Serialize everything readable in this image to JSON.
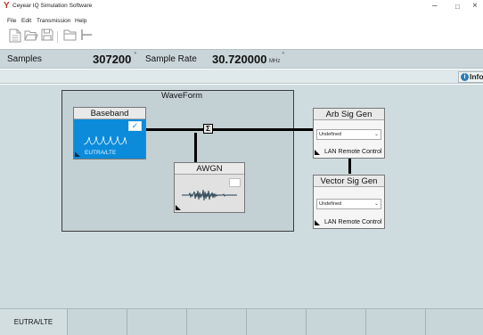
{
  "window": {
    "title": "Ceyear IQ Simulation Software",
    "minimize_glyph": "–",
    "maximize_glyph": "□",
    "close_glyph": "×",
    "icon": "app-logo-icon"
  },
  "menu": {
    "file": "File",
    "edit": "Edit",
    "transmission": "Transmission",
    "help": "Help"
  },
  "toolbar": {
    "icons": [
      "new-file-icon",
      "open-file-icon",
      "save-file-icon",
      "open-folder-icon",
      "branch-icon"
    ]
  },
  "status": {
    "samples_label": "Samples",
    "samples_value": "307200",
    "sample_rate_label": "Sample Rate",
    "sample_rate_value": "30.720000",
    "sample_rate_unit": "MHz"
  },
  "info_tab": {
    "label": "Info",
    "icon_glyph": "i"
  },
  "canvas": {
    "waveform_title": "WaveForm",
    "summing_symbol": "Σ",
    "baseband": {
      "title": "Baseband",
      "standard": "EUTRA/LTE",
      "check_glyph": "✓",
      "enabled": true
    },
    "awgn": {
      "title": "AWGN",
      "enabled": false
    },
    "arb_sig_gen": {
      "title": "Arb Sig Gen",
      "instrument": "Undefined",
      "connection": "LAN Remote Control"
    },
    "vector_sig_gen": {
      "title": "Vector Sig Gen",
      "instrument": "Undefined",
      "connection": "LAN Remote Control"
    }
  },
  "bottom_tabs": [
    "EUTRA/LTE",
    "",
    "",
    "",
    "",
    "",
    "",
    ""
  ],
  "colors": {
    "baseband_fill": "#0b8bda",
    "canvas_bg": "#cfdcdf",
    "status_bg": "#c9d5d9"
  }
}
